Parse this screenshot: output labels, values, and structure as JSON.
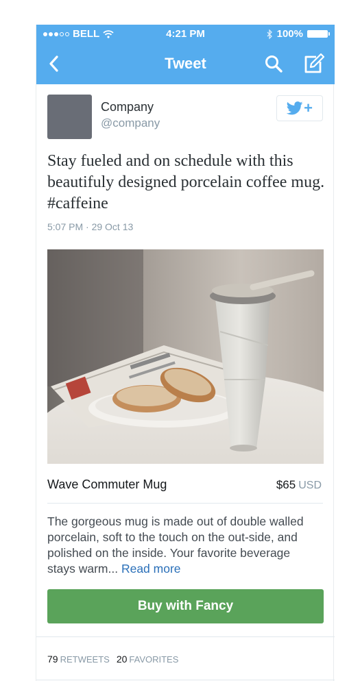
{
  "status_bar": {
    "carrier": "BELL",
    "time": "4:21 PM",
    "battery": "100%"
  },
  "nav": {
    "title": "Tweet",
    "back_icon": "chevron-left-icon",
    "search_icon": "search-icon",
    "compose_icon": "compose-icon"
  },
  "author": {
    "name": "Company",
    "handle": "@company"
  },
  "follow_button": {
    "icon": "twitter-bird-icon",
    "plus": "+"
  },
  "tweet": {
    "text": "Stay fueled and on schedule with this beautifuly designed porcelain coffee mug. #caffeine",
    "timestamp": "5:07 PM · 29 Oct 13"
  },
  "product": {
    "name": "Wave Commuter Mug",
    "price": "$65",
    "currency": "USD",
    "description": "The gorgeous mug is made out of double walled porcelain, soft to the touch on the out-side, and polished on the inside. Your favorite beverage stays warm...",
    "read_more": "Read more",
    "buy_label": "Buy with Fancy"
  },
  "stats": {
    "retweets_count": "79",
    "retweets_label": "RETWEETS",
    "favorites_count": "20",
    "favorites_label": "FAVORITES"
  },
  "colors": {
    "twitter_blue": "#55acee",
    "buy_green": "#5aa35a",
    "link_blue": "#2a6fb8",
    "muted_gray": "#8899a6"
  }
}
